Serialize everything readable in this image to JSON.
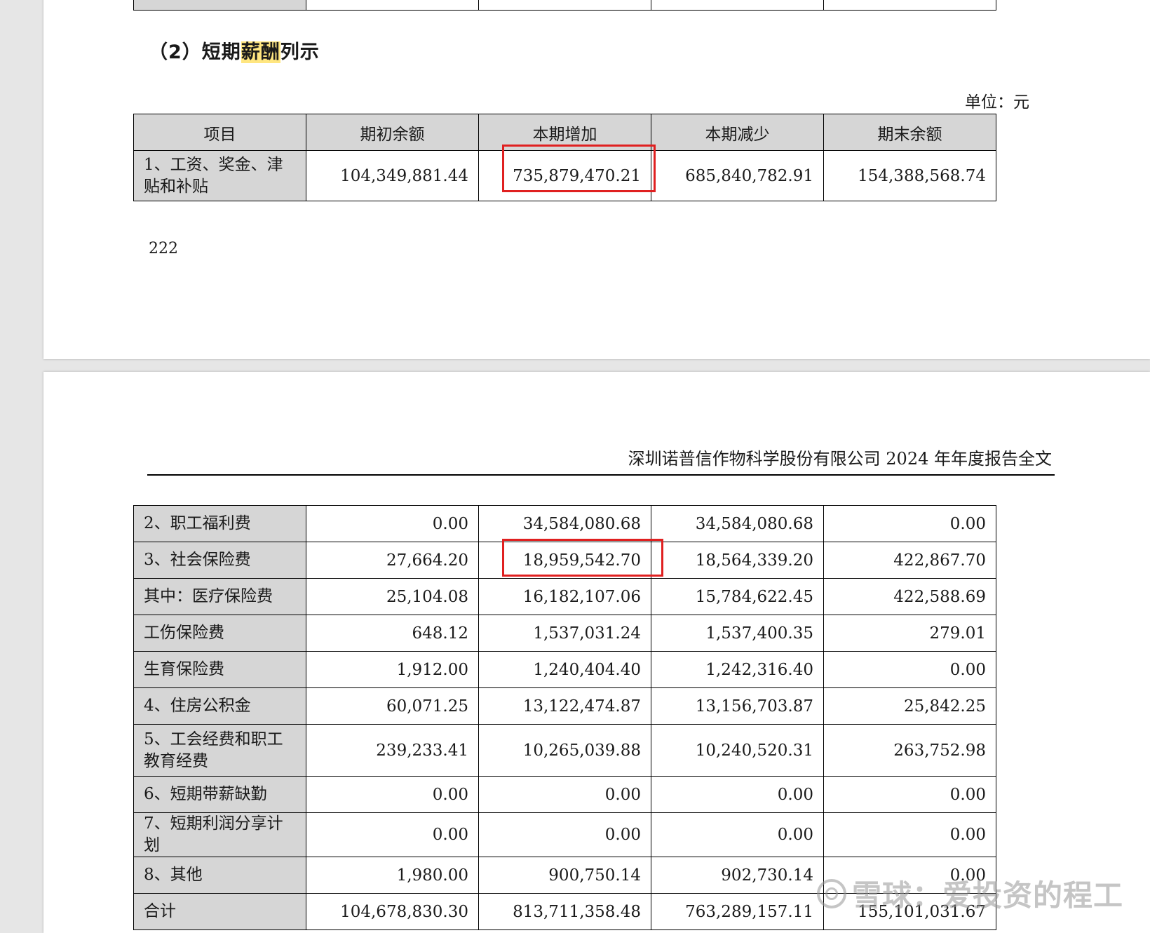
{
  "page1": {
    "top_row_fragment": [
      "",
      "",
      "",
      "",
      ""
    ],
    "section_title_prefix": "（2）短期",
    "section_title_highlight": "薪酬",
    "section_title_suffix": "列示",
    "unit": "单位：元",
    "columns": [
      "项目",
      "期初余额",
      "本期增加",
      "本期减少",
      "期末余额"
    ],
    "rows": [
      {
        "item": "1、工资、奖金、津贴和补贴",
        "opening": "104,349,881.44",
        "increase": "735,879,470.21",
        "decrease": "685,840,782.91",
        "closing": "154,388,568.74"
      }
    ],
    "page_number": "222"
  },
  "page2": {
    "header": "深圳诺普信作物科学股份有限公司 2024 年年度报告全文",
    "rows": [
      {
        "item": "2、职工福利费",
        "opening": "0.00",
        "increase": "34,584,080.68",
        "decrease": "34,584,080.68",
        "closing": "0.00"
      },
      {
        "item": "3、社会保险费",
        "opening": "27,664.20",
        "increase": "18,959,542.70",
        "decrease": "18,564,339.20",
        "closing": "422,867.70"
      },
      {
        "item": "其中：医疗保险费",
        "opening": "25,104.08",
        "increase": "16,182,107.06",
        "decrease": "15,784,622.45",
        "closing": "422,588.69"
      },
      {
        "item": "工伤保险费",
        "opening": "648.12",
        "increase": "1,537,031.24",
        "decrease": "1,537,400.35",
        "closing": "279.01"
      },
      {
        "item": "生育保险费",
        "opening": "1,912.00",
        "increase": "1,240,404.40",
        "decrease": "1,242,316.40",
        "closing": "0.00"
      },
      {
        "item": "4、住房公积金",
        "opening": "60,071.25",
        "increase": "13,122,474.87",
        "decrease": "13,156,703.87",
        "closing": "25,842.25"
      },
      {
        "item": "5、工会经费和职工教育经费",
        "opening": "239,233.41",
        "increase": "10,265,039.88",
        "decrease": "10,240,520.31",
        "closing": "263,752.98"
      },
      {
        "item": "6、短期带薪缺勤",
        "opening": "0.00",
        "increase": "0.00",
        "decrease": "0.00",
        "closing": "0.00"
      },
      {
        "item": "7、短期利润分享计划",
        "opening": "0.00",
        "increase": "0.00",
        "decrease": "0.00",
        "closing": "0.00"
      },
      {
        "item": "8、其他",
        "opening": "1,980.00",
        "increase": "900,750.14",
        "decrease": "902,730.14",
        "closing": "0.00"
      },
      {
        "item": "合计",
        "opening": "104,678,830.30",
        "increase": "813,711,358.48",
        "decrease": "763,289,157.11",
        "closing": "155,101,031.67"
      }
    ]
  },
  "watermark": "雪球：爱投资的程工",
  "colors": {
    "highlight": "#ffe680",
    "annotation_box": "#e02020",
    "header_fill": "#d6d6d6"
  }
}
